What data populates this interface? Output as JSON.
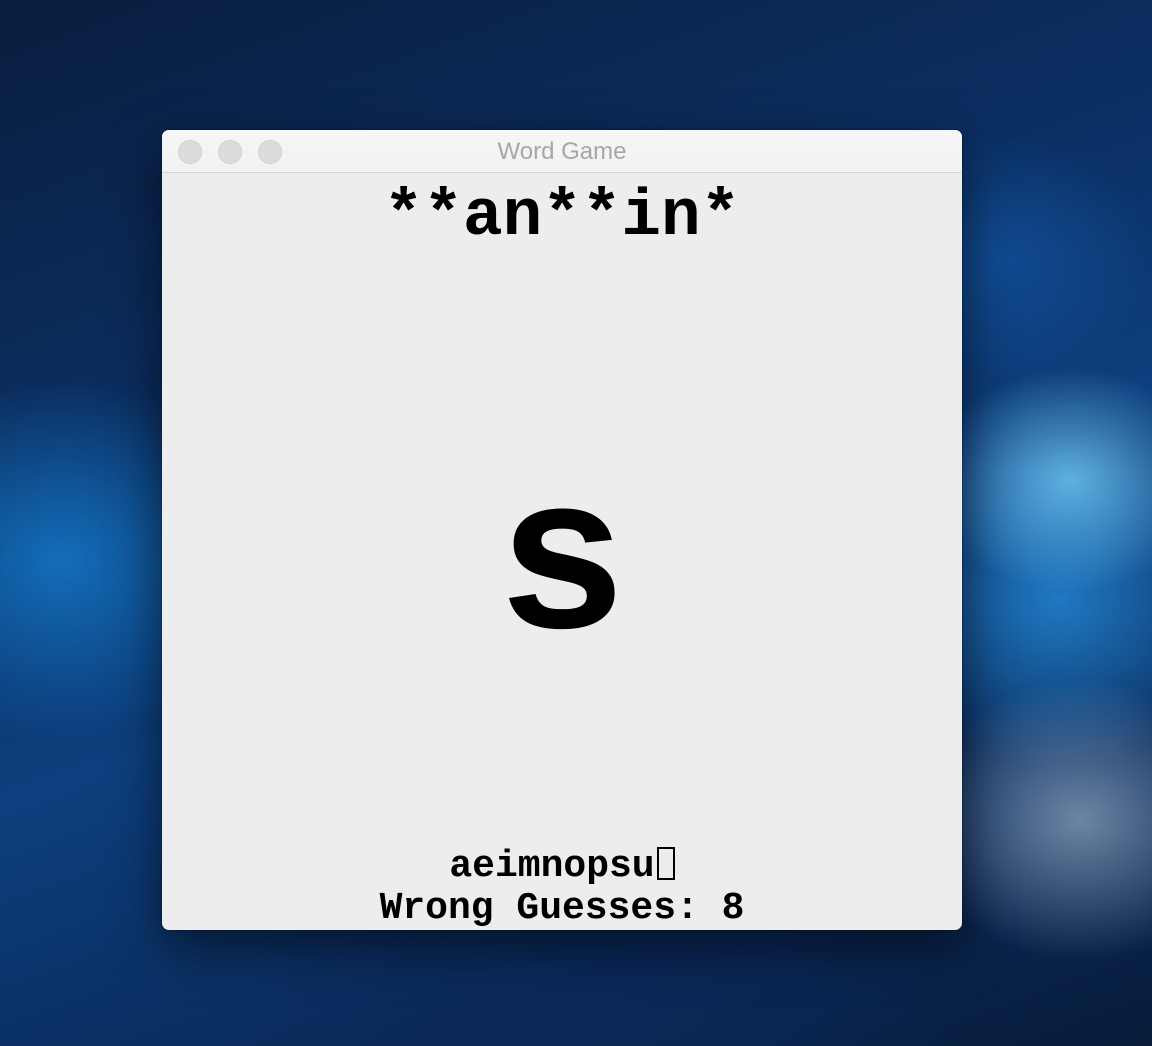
{
  "window": {
    "title": "Word Game"
  },
  "game": {
    "pattern": "**an**in*",
    "current_letter": "s",
    "guessed_letters": "aeimnopsu",
    "wrong_guesses_text": "Wrong Guesses: 8"
  }
}
